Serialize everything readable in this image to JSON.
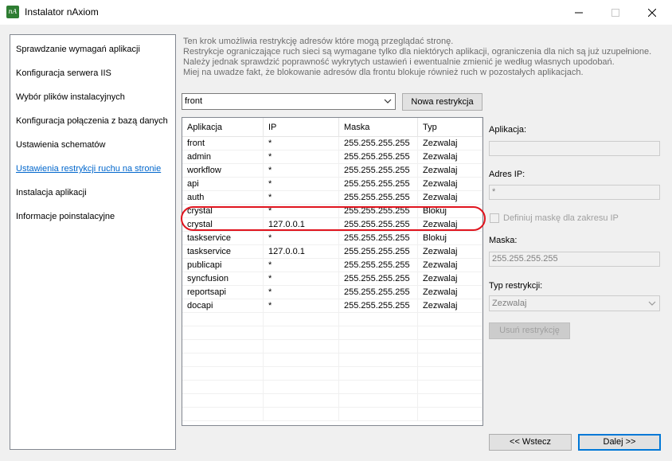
{
  "window": {
    "title": "Instalator nAxiom",
    "icon_text": "nA"
  },
  "steps": [
    {
      "label": "Sprawdzanie wymagań aplikacji",
      "active": false
    },
    {
      "label": "Konfiguracja serwera IIS",
      "active": false
    },
    {
      "label": "Wybór plików instalacyjnych",
      "active": false
    },
    {
      "label": "Konfiguracja połączenia z bazą danych",
      "active": false
    },
    {
      "label": "Ustawienia schematów",
      "active": false
    },
    {
      "label": "Ustawienia restrykcji ruchu na stronie",
      "active": true
    },
    {
      "label": "Instalacja aplikacji",
      "active": false
    },
    {
      "label": "Informacje poinstalacyjne",
      "active": false
    }
  ],
  "description": [
    "Ten krok umożliwia restrykcję adresów które mogą przeglądać stronę.",
    "Restrykcje ograniczające ruch sieci są wymagane tylko dla niektórych aplikacji, ograniczenia dla nich są już uzupełnione.",
    "Należy jednak sprawdzić poprawność wykrytych ustawień i ewentualnie zmienić je według własnych upodobań.",
    "Miej na uwadze fakt, że blokowanie adresów dla frontu blokuje również ruch w pozostałych aplikacjach."
  ],
  "filter": {
    "selected": "front",
    "new_button": "Nowa restrykcja"
  },
  "table": {
    "columns": [
      "Aplikacja",
      "IP",
      "Maska",
      "Typ"
    ],
    "rows": [
      [
        "front",
        "*",
        "255.255.255.255",
        "Zezwalaj"
      ],
      [
        "admin",
        "*",
        "255.255.255.255",
        "Zezwalaj"
      ],
      [
        "workflow",
        "*",
        "255.255.255.255",
        "Zezwalaj"
      ],
      [
        "api",
        "*",
        "255.255.255.255",
        "Zezwalaj"
      ],
      [
        "auth",
        "*",
        "255.255.255.255",
        "Zezwalaj"
      ],
      [
        "crystal",
        "*",
        "255.255.255.255",
        "Blokuj"
      ],
      [
        "crystal",
        "127.0.0.1",
        "255.255.255.255",
        "Zezwalaj"
      ],
      [
        "taskservice",
        "*",
        "255.255.255.255",
        "Blokuj"
      ],
      [
        "taskservice",
        "127.0.0.1",
        "255.255.255.255",
        "Zezwalaj"
      ],
      [
        "publicapi",
        "*",
        "255.255.255.255",
        "Zezwalaj"
      ],
      [
        "syncfusion",
        "*",
        "255.255.255.255",
        "Zezwalaj"
      ],
      [
        "reportsapi",
        "*",
        "255.255.255.255",
        "Zezwalaj"
      ],
      [
        "docapi",
        "*",
        "255.255.255.255",
        "Zezwalaj"
      ]
    ],
    "empty_rows": 8
  },
  "details": {
    "app_label": "Aplikacja:",
    "app_value": "",
    "ip_label": "Adres IP:",
    "ip_value": "*",
    "mask_checkbox_label": "Definiuj maskę dla zakresu IP",
    "mask_checkbox_checked": false,
    "mask_label": "Maska:",
    "mask_value": "255.255.255.255",
    "type_label": "Typ restrykcji:",
    "type_value": "Zezwalaj",
    "remove_button": "Usuń restrykcję"
  },
  "nav": {
    "back": "<< Wstecz",
    "next": "Dalej >>"
  },
  "colors": {
    "accent": "#0078d7",
    "active_step": "#0066cc",
    "highlight": "#e0141e"
  }
}
